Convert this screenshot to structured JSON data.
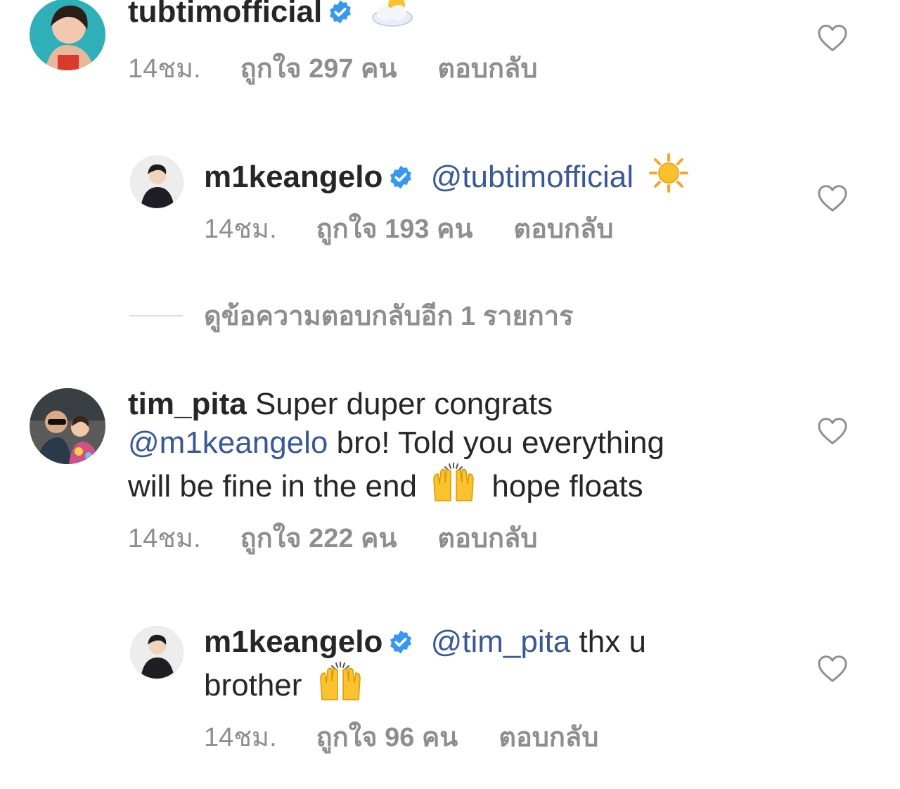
{
  "comments": [
    {
      "username": "tubtimofficial",
      "time": "14ชม.",
      "likes": "ถูกใจ 297 คน",
      "reply": "ตอบกลับ",
      "emoji": "sun-behind-cloud"
    },
    {
      "username": "m1keangelo",
      "mention": "@tubtimofficial",
      "time": "14ชม.",
      "likes": "ถูกใจ 193 คน",
      "reply": "ตอบกลับ",
      "emoji": "sun"
    },
    {
      "username": "tim_pita",
      "text_line1": "Super duper congrats",
      "mention": "@m1keangelo",
      "text_line2": "bro! Told you everything",
      "text_line3a": "will be fine in the end",
      "text_line3b": "hope floats",
      "time": "14ชม.",
      "likes": "ถูกใจ 222 คน",
      "reply": "ตอบกลับ",
      "emoji": "raising-hands"
    },
    {
      "username": "m1keangelo",
      "mention": "@tim_pita",
      "text_line1": "thx u",
      "text_line2": "brother",
      "time": "14ชม.",
      "likes": "ถูกใจ 96 คน",
      "reply": "ตอบกลับ",
      "emoji": "raising-hands"
    }
  ],
  "view_replies": "ดูข้อความตอบกลับอีก 1 รายการ",
  "colors": {
    "text": "#262626",
    "meta": "#8e8e8e",
    "mention": "#385898",
    "verified": "#3897f0",
    "divider": "#dbdbdb"
  }
}
